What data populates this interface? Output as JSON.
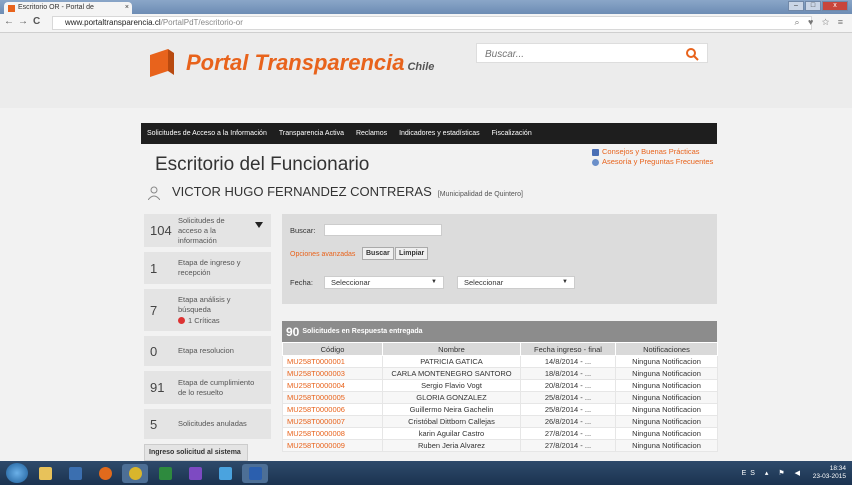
{
  "browser": {
    "tab_title": "Escritorio OR - Portal de ",
    "tab_close": "×",
    "url_host": "www.portaltransparencia.cl",
    "url_path": "/PortalPdT/escritorio-or",
    "back": "←",
    "forward": "→",
    "reload": "C",
    "win_min": "–",
    "win_max": "□",
    "win_close": "x"
  },
  "header": {
    "logo_main": "Portal Transparencia",
    "logo_sub": "Chile",
    "search_placeholder": "Buscar...",
    "brand_color": "#e8631c"
  },
  "nav": {
    "items": [
      "Solicitudes de Acceso a la Información",
      "Transparencia Activa",
      "Reclamos",
      "Indicadores y estadísticas",
      "Fiscalización"
    ]
  },
  "page": {
    "title": "Escritorio del Funcionario",
    "user_name": "VICTOR HUGO FERNANDEZ CONTRERAS",
    "user_org": "[Municipalidad de Quintero]",
    "links": [
      "Consejos y Buenas Prácticas",
      "Asesoría y Preguntas Frecuentes"
    ]
  },
  "sidebar": {
    "items": [
      {
        "count": "104",
        "label": "Solicitudes de acceso a la información"
      },
      {
        "count": "1",
        "label": "Etapa de ingreso y recepción"
      },
      {
        "count": "7",
        "label": "Etapa análisis y búsqueda",
        "critical": "1 Críticas"
      },
      {
        "count": "0",
        "label": "Etapa resolucion"
      },
      {
        "count": "91",
        "label": "Etapa de cumplimiento de lo resuelto"
      },
      {
        "count": "5",
        "label": "Solicitudes anuladas"
      }
    ],
    "ingreso_button": "Ingreso solicitud al sistema"
  },
  "filter": {
    "search_label": "Buscar:",
    "advanced_link": "Opciones avanzadas",
    "search_button": "Buscar",
    "clear_button": "Limpiar",
    "date_label": "Fecha:",
    "select1": "Seleccionar",
    "select2": "Seleccionar"
  },
  "results": {
    "count": "90",
    "title": "Solicitudes en Respuesta entregada",
    "columns": [
      "Código",
      "Nombre",
      "Fecha ingreso - final",
      "Notificaciones"
    ],
    "rows": [
      [
        "MU258T0000001",
        "PATRICIA GATICA",
        "14/8/2014 - ...",
        "Ninguna Notificacion"
      ],
      [
        "MU258T0000003",
        "CARLA MONTENEGRO SANTORO",
        "18/8/2014 - ...",
        "Ninguna Notificacion"
      ],
      [
        "MU258T0000004",
        "Sergio Flavio Vogt",
        "20/8/2014 - ...",
        "Ninguna Notificacion"
      ],
      [
        "MU258T0000005",
        "GLORIA GONZALEZ",
        "25/8/2014 - ...",
        "Ninguna Notificacion"
      ],
      [
        "MU258T0000006",
        "Guillermo Neira Gachelin",
        "25/8/2014 - ...",
        "Ninguna Notificacion"
      ],
      [
        "MU258T0000007",
        "Cristóbal Dittborn Callejas",
        "26/8/2014 - ...",
        "Ninguna Notificacion"
      ],
      [
        "MU258T0000008",
        "karin Aguilar Castro",
        "27/8/2014 - ...",
        "Ninguna Notificacion"
      ],
      [
        "MU258T0000009",
        "Ruben Jeria Alvarez",
        "27/8/2014 - ...",
        "Ninguna Notificacion"
      ]
    ]
  },
  "taskbar": {
    "lang": "ES",
    "time": "18:34",
    "date": "23-03-2015"
  }
}
